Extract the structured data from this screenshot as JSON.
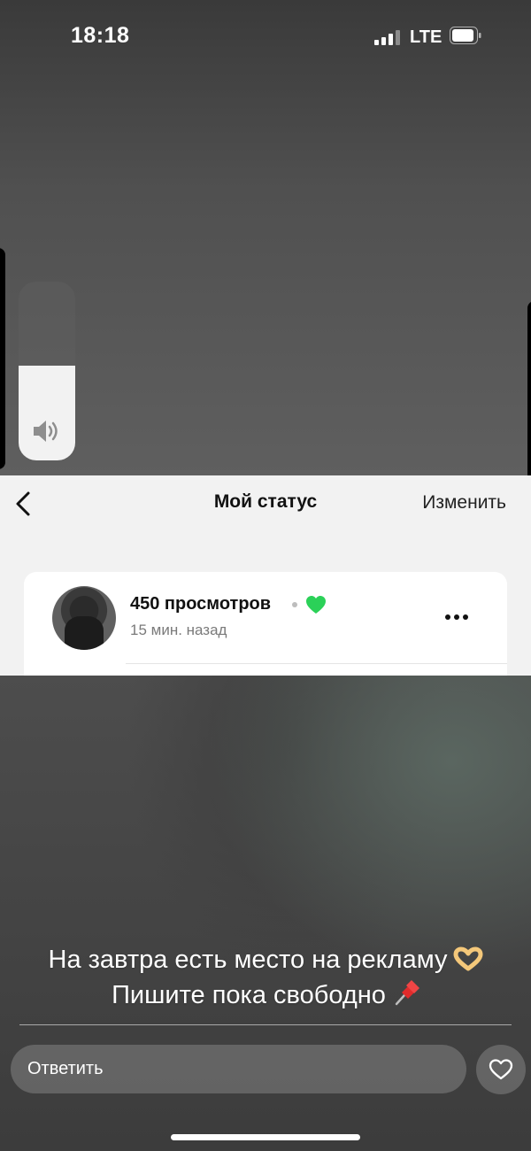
{
  "status_bar": {
    "time": "18:18",
    "network": "LTE",
    "signal_bars_active": 3,
    "signal_bars_total": 4,
    "battery_level": 0.8
  },
  "volume": {
    "level": 0.53,
    "icon": "speaker-icon"
  },
  "status_screen": {
    "title": "Мой статус",
    "back_icon": "chevron-left-icon",
    "edit_label": "Изменить",
    "views": "450 просмотров",
    "time_ago": "15 мин. назад",
    "heart_color": "#2bd158",
    "more_icon": "ellipsis-icon"
  },
  "caption": {
    "line1": "На завтра есть место на рекламу",
    "line2": "Пишите пока свободно",
    "emoji1": "heart-hands-emoji",
    "emoji2": "pushpin-emoji"
  },
  "reply": {
    "placeholder": "Ответить",
    "like_icon": "heart-outline-icon"
  }
}
